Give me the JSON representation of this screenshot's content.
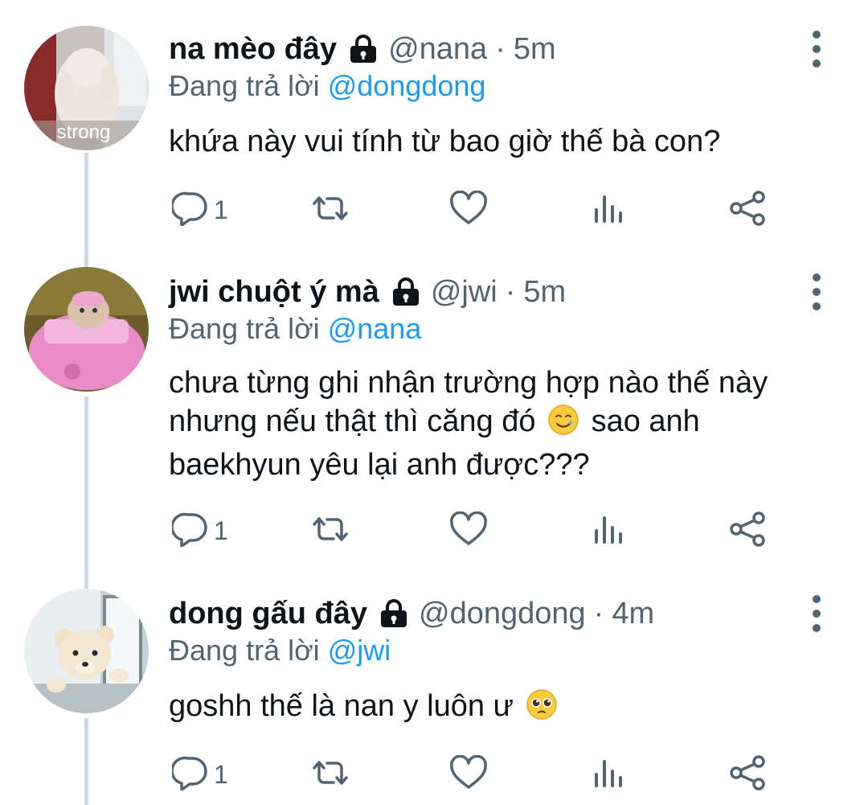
{
  "thread": [
    {
      "display_name": "na mèo đây",
      "handle": "@nana",
      "separator": "·",
      "time": "5m",
      "reply_prefix": "Đang trả lời",
      "reply_to": "@dongdong",
      "text_lines": [
        "khứa này vui tính từ bao giờ thế bà con?"
      ],
      "avatar_label": "strong",
      "avatar_icon": "cat-photo-avatar",
      "reply_count": "1"
    },
    {
      "display_name": "jwi chuột ý mà",
      "handle": "@jwi",
      "separator": "·",
      "time": "5m",
      "reply_prefix": "Đang trả lời",
      "reply_to": "@nana",
      "text_lines": [
        "chưa từng ghi nhận trường hợp nào thế này",
        "nhưng nếu thật thì căng đó",
        "sao anh",
        "baekhyun yêu lại anh được???"
      ],
      "emoji": "smiling-face-with-tear",
      "avatar_icon": "hamster-in-pink-car-avatar",
      "reply_count": "1"
    },
    {
      "display_name": "dong gấu đây",
      "handle": "@dongdong",
      "separator": "·",
      "time": "4m",
      "reply_prefix": "Đang trả lời",
      "reply_to": "@jwi",
      "text_lines": [
        "goshh thế là nan y luôn ư"
      ],
      "emoji": "pleading-face",
      "avatar_icon": "teddy-bear-window-avatar",
      "reply_count": "1"
    }
  ],
  "colors": {
    "text": "#0f1419",
    "secondary": "#536471",
    "mention": "#1d9bf0",
    "thread_line": "#cfd9de"
  },
  "icons": [
    "lock-icon",
    "reply-icon",
    "retweet-icon",
    "like-icon",
    "views-icon",
    "share-icon",
    "more-icon"
  ]
}
